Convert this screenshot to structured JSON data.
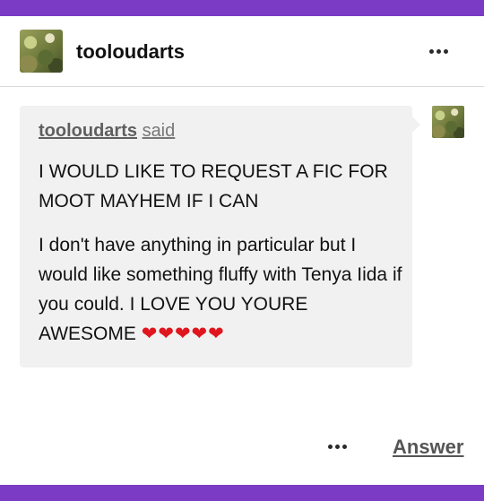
{
  "post": {
    "username": "tooloudarts",
    "asker": "tooloudarts",
    "said_word": "said",
    "question_line1": "I WOULD LIKE TO REQUEST A FIC FOR MOOT MAYHEM IF I CAN",
    "question_line2": "I don't have anything in particular but I would like something fluffy with Tenya Iida if you could. I LOVE YOU YOURE AWESOME",
    "hearts": "❤❤❤❤❤",
    "answer_label": "Answer"
  },
  "icons": {
    "header_menu": "more-dots-icon",
    "footer_menu": "more-dots-icon",
    "heart": "heart-icon"
  },
  "colors": {
    "accent_bar": "#7b3bc4",
    "bubble_bg": "#f1f1f1",
    "heart": "#e0161f"
  }
}
